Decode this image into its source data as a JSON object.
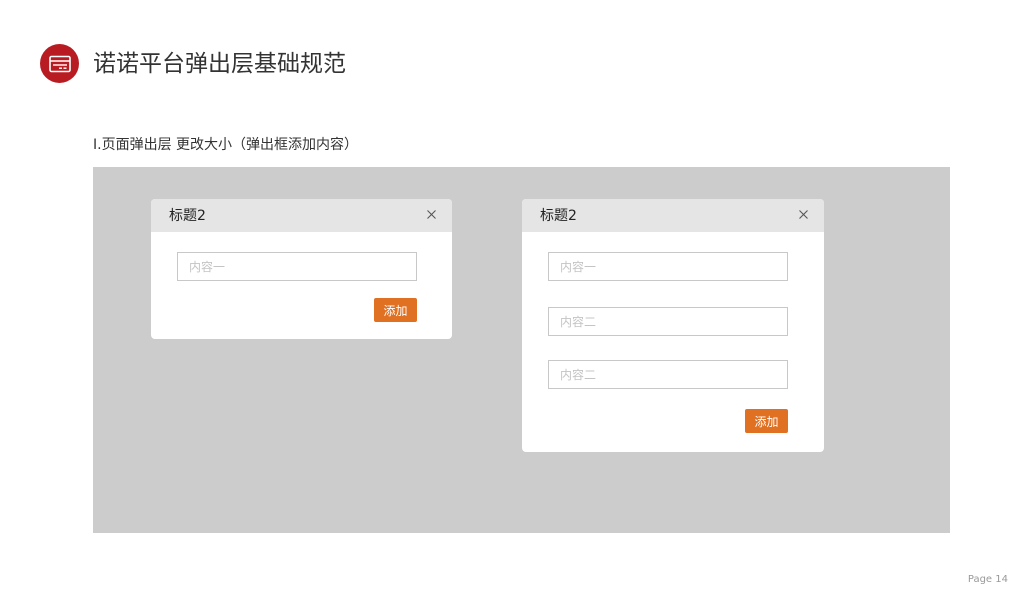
{
  "header": {
    "icon": "card-icon",
    "accent_color": "#b81c22",
    "title": "诺诺平台弹出层基础规范"
  },
  "section": {
    "label": "I.页面弹出层 更改大小（弹出框添加内容）"
  },
  "dialogs": [
    {
      "title": "标题2",
      "close_icon": "close-icon",
      "fields": [
        {
          "placeholder": "内容一",
          "value": ""
        }
      ],
      "add_label": "添加"
    },
    {
      "title": "标题2",
      "close_icon": "close-icon",
      "fields": [
        {
          "placeholder": "内容一",
          "value": ""
        },
        {
          "placeholder": "内容二",
          "value": ""
        },
        {
          "placeholder": "内容二",
          "value": ""
        }
      ],
      "add_label": "添加"
    }
  ],
  "button_color": "#e07022",
  "footer": {
    "page": "Page 14"
  }
}
